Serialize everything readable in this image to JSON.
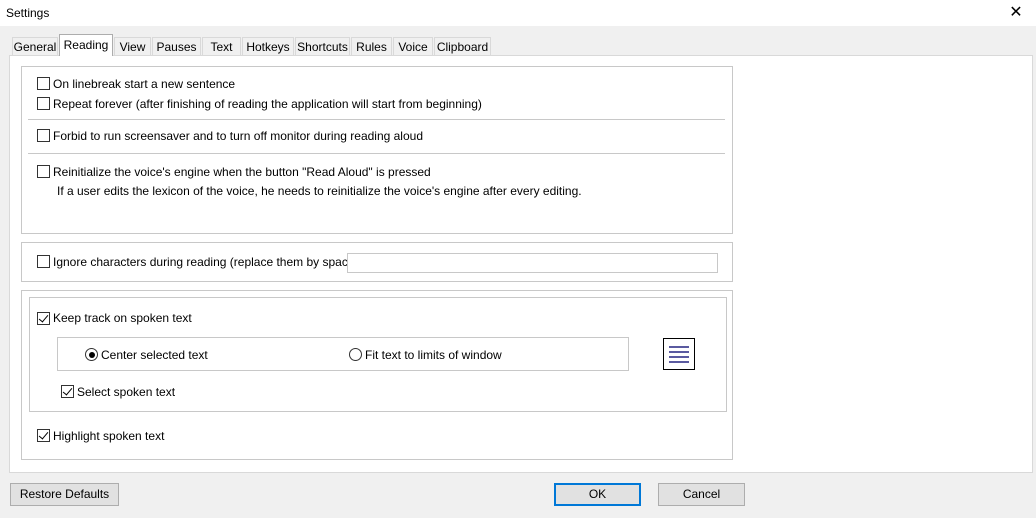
{
  "window": {
    "title": "Settings",
    "close_glyph": "✕"
  },
  "tabs": [
    {
      "label": "General"
    },
    {
      "label": "Reading"
    },
    {
      "label": "View"
    },
    {
      "label": "Pauses"
    },
    {
      "label": "Text"
    },
    {
      "label": "Hotkeys"
    },
    {
      "label": "Shortcuts"
    },
    {
      "label": "Rules"
    },
    {
      "label": "Voice"
    },
    {
      "label": "Clipboard"
    }
  ],
  "active_tab": "Reading",
  "options": {
    "linebreak": {
      "label": "On linebreak start a new sentence",
      "checked": false
    },
    "repeat": {
      "label": "Repeat forever (after finishing of reading the application will start from beginning)",
      "checked": false
    },
    "screensaver": {
      "label": "Forbid to run screensaver and to turn off monitor during reading aloud",
      "checked": false
    },
    "reinit": {
      "label": "Reinitialize the voice's engine when the button \"Read Aloud\" is pressed",
      "checked": false
    },
    "reinit_note": "If a user edits the lexicon of the voice, he needs to reinitialize the voice's engine after every editing.",
    "ignore": {
      "label": "Ignore characters during reading (replace them by spaces):",
      "checked": false,
      "value": ""
    },
    "keep_track": {
      "label": "Keep track on spoken text",
      "checked": true
    },
    "center": {
      "label": "Center selected text",
      "selected": true
    },
    "fit": {
      "label": "Fit text to limits of window",
      "selected": false
    },
    "select_spoken": {
      "label": "Select spoken text",
      "checked": true
    },
    "highlight": {
      "label": "Highlight spoken text",
      "checked": true
    }
  },
  "icons": {
    "preview": "text-alignment-preview-icon"
  },
  "buttons": {
    "restore": "Restore Defaults",
    "ok": "OK",
    "cancel": "Cancel"
  }
}
